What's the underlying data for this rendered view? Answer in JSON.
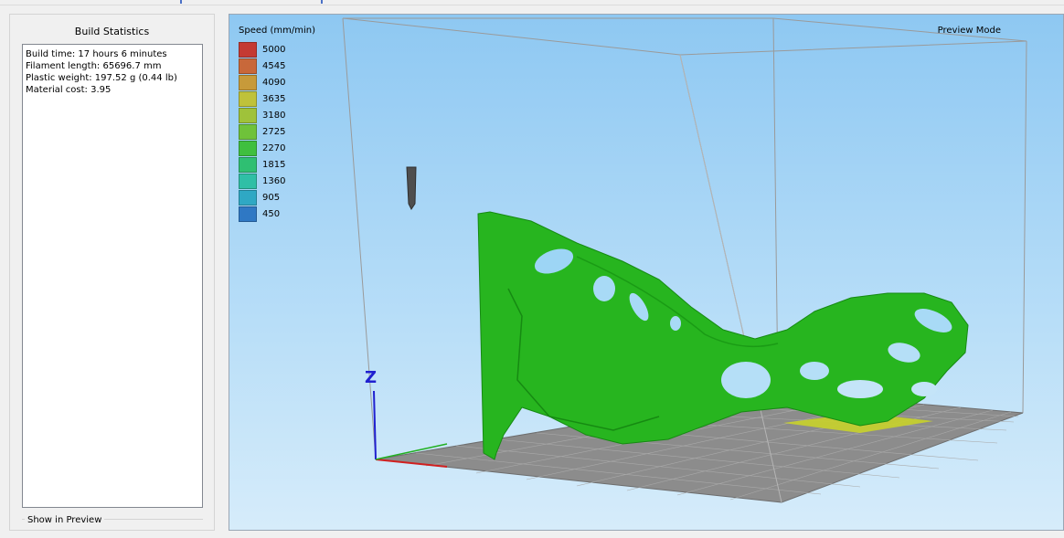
{
  "build_statistics": {
    "title": "Build Statistics",
    "lines": [
      "Build time: 17 hours 6 minutes",
      "Filament length: 65696.7 mm",
      "Plastic weight: 197.52 g (0.44 lb)",
      "Material cost: 3.95"
    ]
  },
  "show_in_preview": {
    "label": "Show in Preview"
  },
  "viewport": {
    "mode_label": "Preview Mode",
    "axis_label": "Z",
    "legend": {
      "title": "Speed (mm/min)",
      "items": [
        {
          "value": "5000",
          "color": "#c43a33"
        },
        {
          "value": "4545",
          "color": "#c8683a"
        },
        {
          "value": "4090",
          "color": "#c79a3a"
        },
        {
          "value": "3635",
          "color": "#bfc23a"
        },
        {
          "value": "3180",
          "color": "#9fc23a"
        },
        {
          "value": "2725",
          "color": "#6fc23a"
        },
        {
          "value": "2270",
          "color": "#3fbf3f"
        },
        {
          "value": "1815",
          "color": "#2fbf72"
        },
        {
          "value": "1360",
          "color": "#2fbfa6"
        },
        {
          "value": "905",
          "color": "#2fa8c4"
        },
        {
          "value": "450",
          "color": "#2f78c4"
        }
      ]
    },
    "colors": {
      "model": "#27b51f",
      "model_dark": "#168a12",
      "bed": "#8c8c8c",
      "highlight": "#c8d22a"
    }
  }
}
